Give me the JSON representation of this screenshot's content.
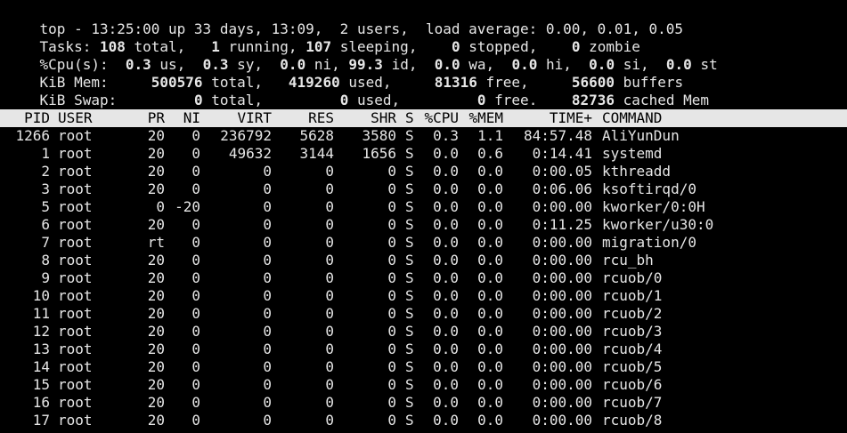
{
  "summary": {
    "line1": {
      "prefix": "top - 13:25:00 up 33 days, 13:09,  2 users,  load average: 0.00, 0.01, 0.05"
    },
    "tasks": {
      "label": "Tasks:",
      "total": "108",
      "total_label": "total,",
      "running": "1",
      "running_label": "running,",
      "sleeping": "107",
      "sleeping_label": "sleeping,",
      "stopped": "0",
      "stopped_label": "stopped,",
      "zombie": "0",
      "zombie_label": "zombie"
    },
    "cpu": {
      "label": "%Cpu(s):",
      "us": "0.3",
      "us_label": "us,",
      "sy": "0.3",
      "sy_label": "sy,",
      "ni": "0.0",
      "ni_label": "ni,",
      "id": "99.3",
      "id_label": "id,",
      "wa": "0.0",
      "wa_label": "wa,",
      "hi": "0.0",
      "hi_label": "hi,",
      "si": "0.0",
      "si_label": "si,",
      "st": "0.0",
      "st_label": "st"
    },
    "mem": {
      "label": "KiB Mem:",
      "total": "500576",
      "total_label": "total,",
      "used": "419260",
      "used_label": "used,",
      "free": "81316",
      "free_label": "free,",
      "buffers": "56600",
      "buffers_label": "buffers"
    },
    "swap": {
      "label": "KiB Swap:",
      "total": "0",
      "total_label": "total,",
      "used": "0",
      "used_label": "used,",
      "free": "0",
      "free_label": "free.",
      "cached": "82736",
      "cached_label": "cached Mem"
    }
  },
  "table": {
    "headers": [
      "PID",
      "USER",
      "PR",
      "NI",
      "VIRT",
      "RES",
      "SHR",
      "S",
      "%CPU",
      "%MEM",
      "TIME+",
      "COMMAND"
    ],
    "rows": [
      [
        "1266",
        "root",
        "20",
        "0",
        "236792",
        "5628",
        "3580",
        "S",
        "0.3",
        "1.1",
        "84:57.48",
        "AliYunDun"
      ],
      [
        "1",
        "root",
        "20",
        "0",
        "49632",
        "3144",
        "1656",
        "S",
        "0.0",
        "0.6",
        "0:14.41",
        "systemd"
      ],
      [
        "2",
        "root",
        "20",
        "0",
        "0",
        "0",
        "0",
        "S",
        "0.0",
        "0.0",
        "0:00.05",
        "kthreadd"
      ],
      [
        "3",
        "root",
        "20",
        "0",
        "0",
        "0",
        "0",
        "S",
        "0.0",
        "0.0",
        "0:06.06",
        "ksoftirqd/0"
      ],
      [
        "5",
        "root",
        "0",
        "-20",
        "0",
        "0",
        "0",
        "S",
        "0.0",
        "0.0",
        "0:00.00",
        "kworker/0:0H"
      ],
      [
        "6",
        "root",
        "20",
        "0",
        "0",
        "0",
        "0",
        "S",
        "0.0",
        "0.0",
        "0:11.25",
        "kworker/u30:0"
      ],
      [
        "7",
        "root",
        "rt",
        "0",
        "0",
        "0",
        "0",
        "S",
        "0.0",
        "0.0",
        "0:00.00",
        "migration/0"
      ],
      [
        "8",
        "root",
        "20",
        "0",
        "0",
        "0",
        "0",
        "S",
        "0.0",
        "0.0",
        "0:00.00",
        "rcu_bh"
      ],
      [
        "9",
        "root",
        "20",
        "0",
        "0",
        "0",
        "0",
        "S",
        "0.0",
        "0.0",
        "0:00.00",
        "rcuob/0"
      ],
      [
        "10",
        "root",
        "20",
        "0",
        "0",
        "0",
        "0",
        "S",
        "0.0",
        "0.0",
        "0:00.00",
        "rcuob/1"
      ],
      [
        "11",
        "root",
        "20",
        "0",
        "0",
        "0",
        "0",
        "S",
        "0.0",
        "0.0",
        "0:00.00",
        "rcuob/2"
      ],
      [
        "12",
        "root",
        "20",
        "0",
        "0",
        "0",
        "0",
        "S",
        "0.0",
        "0.0",
        "0:00.00",
        "rcuob/3"
      ],
      [
        "13",
        "root",
        "20",
        "0",
        "0",
        "0",
        "0",
        "S",
        "0.0",
        "0.0",
        "0:00.00",
        "rcuob/4"
      ],
      [
        "14",
        "root",
        "20",
        "0",
        "0",
        "0",
        "0",
        "S",
        "0.0",
        "0.0",
        "0:00.00",
        "rcuob/5"
      ],
      [
        "15",
        "root",
        "20",
        "0",
        "0",
        "0",
        "0",
        "S",
        "0.0",
        "0.0",
        "0:00.00",
        "rcuob/6"
      ],
      [
        "16",
        "root",
        "20",
        "0",
        "0",
        "0",
        "0",
        "S",
        "0.0",
        "0.0",
        "0:00.00",
        "rcuob/7"
      ],
      [
        "17",
        "root",
        "20",
        "0",
        "0",
        "0",
        "0",
        "S",
        "0.0",
        "0.0",
        "0:00.00",
        "rcuob/8"
      ]
    ]
  },
  "colors": {
    "background": "#000000",
    "foreground": "#e6e6e6",
    "header_background": "#e6e6e6",
    "header_foreground": "#000000"
  }
}
